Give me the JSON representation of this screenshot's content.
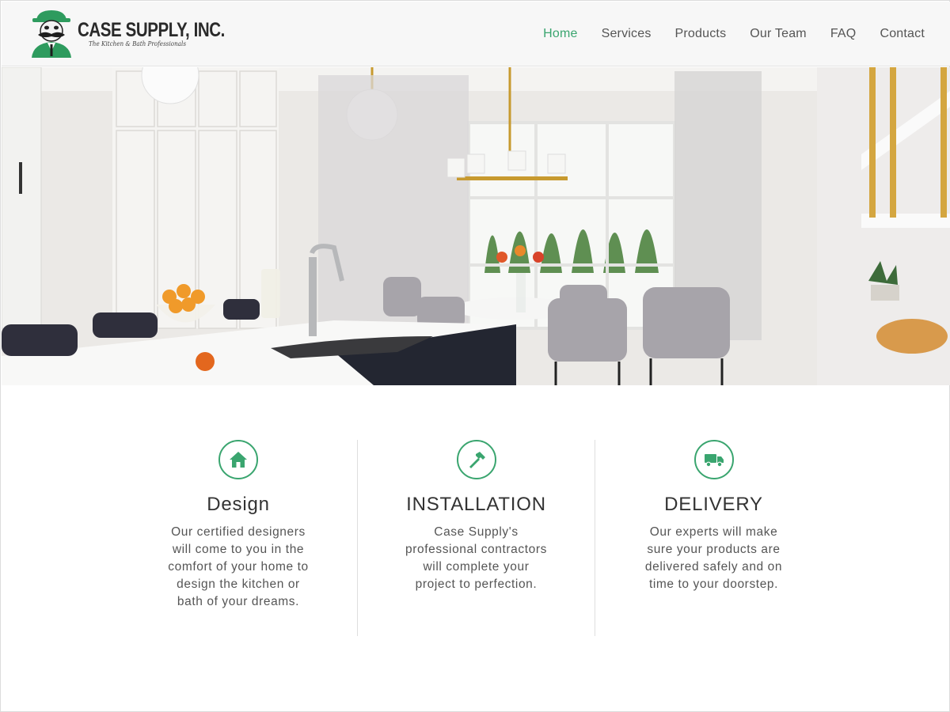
{
  "brand": {
    "name": "CASE SUPPLY, INC.",
    "tagline": "The Kitchen & Bath Professionals",
    "accent_color": "#3aa56f",
    "logo_icon": "mascot-logo-icon"
  },
  "nav": {
    "items": [
      {
        "label": "Home",
        "active": true
      },
      {
        "label": "Services",
        "active": false
      },
      {
        "label": "Products",
        "active": false
      },
      {
        "label": "Our Team",
        "active": false
      },
      {
        "label": "FAQ",
        "active": false
      },
      {
        "label": "Contact",
        "active": false
      }
    ]
  },
  "hero": {
    "image": "kitchen-interior-photo"
  },
  "features": [
    {
      "icon": "home-icon",
      "title": "Design",
      "text": "Our certified designers will come to you in the comfort of your home to design the kitchen or bath of your dreams."
    },
    {
      "icon": "hammer-icon",
      "title": "INSTALLATION",
      "text": "Case Supply's professional contractors will complete your project to perfection."
    },
    {
      "icon": "truck-icon",
      "title": "DELIVERY",
      "text": "Our experts will make sure your products are delivered safely and on time to your doorstep."
    }
  ]
}
